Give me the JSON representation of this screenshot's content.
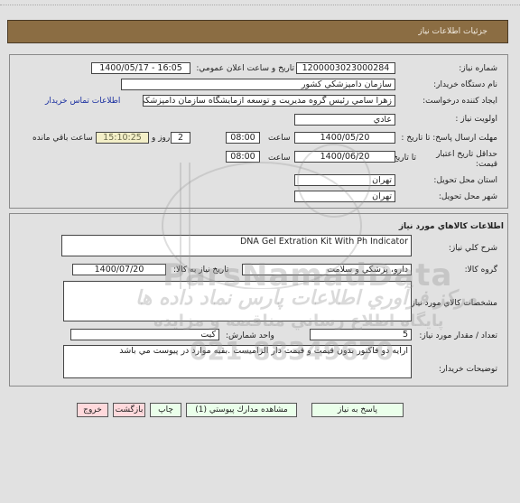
{
  "header": {
    "title": "جزئيات اطلاعات نياز"
  },
  "need_info": {
    "need_number_label": "شماره نياز:",
    "need_number": "1200003023000284",
    "announce_label": "تاريخ و ساعت اعلان عمومي:",
    "announce_value": "1400/05/17 - 16:05",
    "buyer_org_label": "نام دستگاه خريدار:",
    "buyer_org": "سازمان دامپزشكي كشور",
    "creator_label": "ايجاد كننده درخواست:",
    "creator": "زهرا سامي  رئيس گروه مديريت و توسعه آزمايشگاه سازمان دامپزشكي كشور",
    "contact_link": "اطلاعات تماس خريدار",
    "priority_label": "اولويت نياز :",
    "priority": "عادي",
    "reply_deadline_label": "مهلت ارسال پاسخ: تا تاريخ :",
    "reply_deadline_date": "1400/05/20",
    "time_label": "ساعت",
    "reply_deadline_time": "08:00",
    "days_remaining": "2",
    "days_and_label": "روز و",
    "time_remaining": "15:10:25",
    "time_remaining_label": "ساعت باقي مانده",
    "price_validity_label": "حداقل تاريخ اعتبار قيمت:",
    "until_date_label": "تا تاريخ :",
    "price_validity_date": "1400/06/20",
    "price_validity_time": "08:00",
    "delivery_province_label": "استان محل تحويل:",
    "delivery_province": "تهران",
    "delivery_city_label": "شهر محل تحويل:",
    "delivery_city": "تهران"
  },
  "goods_info": {
    "section_title": "اطلاعات كالاهاي مورد نياز",
    "general_desc_label": "شرح كلي نياز:",
    "general_desc": "DNA Gel Extration Kit With Ph Indicator",
    "goods_group_label": "گروه كالا:",
    "goods_group": "دارو، پزشكي و سلامت",
    "goods_need_date_label": "تاريخ نياز به كالا:",
    "goods_need_date": "1400/07/20",
    "specs_label": "مشخصات كالاي مورد نياز:",
    "specs": "",
    "quantity_label": "تعداد / مقدار مورد نياز:",
    "quantity": "5",
    "unit_label": "واحد شمارش:",
    "unit": "كيت",
    "buyer_notes_label": "توضيحات خريدار:",
    "buyer_notes": "ارايه دو فاكتور بدون قيمت و قيمت دار الزاميست .بقيه موارد در پيوست مي باشد"
  },
  "buttons": {
    "respond": "پاسخ به نياز",
    "view_attachments": "مشاهده مدارك پيوستي (1)",
    "print": "چاپ",
    "back": "بازگشت",
    "exit": "خروج"
  },
  "watermark": {
    "brand": "ParsNamadData",
    "line1": "مركز فرآوري اطلاعات پارس نماد داده ها",
    "line2": "پايگاه اطلاع رساني مناقصه و مزايده",
    "phone": "021-88349670"
  }
}
